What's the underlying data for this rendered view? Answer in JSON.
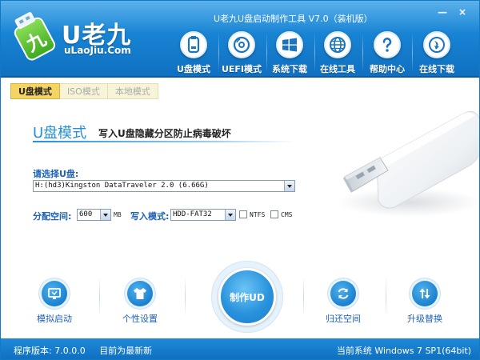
{
  "window": {
    "title": "U老九U盘启动制作工具 V7.0（装机版）",
    "minimize_glyph": "—",
    "close_glyph": "×"
  },
  "brand": {
    "name_cn": "U老九",
    "name_en": "uLaoJiu.Com"
  },
  "nav": {
    "items": [
      {
        "label": "U盘模式",
        "icon": "usb-drive-icon"
      },
      {
        "label": "UEFI模式",
        "icon": "disc-icon"
      },
      {
        "label": "系统下载",
        "icon": "windows-logo-icon"
      },
      {
        "label": "在线工具",
        "icon": "globe-icon"
      },
      {
        "label": "帮助中心",
        "icon": "question-icon"
      },
      {
        "label": "在线下载",
        "icon": "download-icon"
      }
    ]
  },
  "tabs": [
    {
      "label": "U盘模式",
      "active": true
    },
    {
      "label": "ISO模式",
      "active": false
    },
    {
      "label": "本地模式",
      "active": false
    }
  ],
  "main": {
    "title": "U盘模式",
    "subtitle": "写入U盘隐藏分区防止病毒破坏",
    "select_label": "请选择U盘:",
    "device_value": "H:(hd3)Kingston DataTraveler 2.0 (6.66G)",
    "partition_label": "分配空间:",
    "partition_value": "600",
    "partition_unit": "MB",
    "write_mode_label": "写入模式:",
    "write_mode_value": "HDD-FAT32",
    "ntfs_label": "NTFS",
    "cms_label": "CMS",
    "ntfs_checked": false,
    "cms_checked": false
  },
  "actions": {
    "simulate": "模拟启动",
    "personalize": "个性设置",
    "make": "制作UD",
    "restore": "归还空间",
    "upgrade": "升级替换"
  },
  "status": {
    "version": "程序版本: 7.0.0.0",
    "update": "目前为最新新",
    "os": "当前系统 Windows 7 SP1(64bit)"
  },
  "colors": {
    "header_blue": "#1883d3",
    "accent_blue": "#2291d9",
    "label_blue": "#1e62b8",
    "tab_active": "#f4d463"
  }
}
